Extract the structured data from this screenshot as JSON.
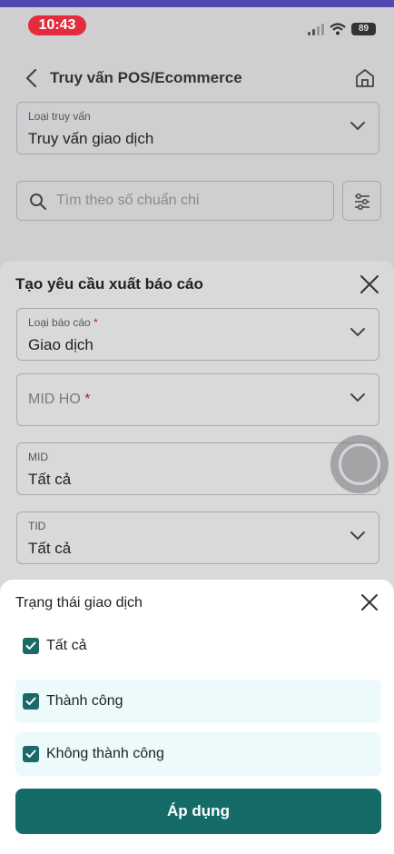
{
  "status_bar": {
    "time": "10:43",
    "battery": "89"
  },
  "nav": {
    "title": "Truy vấn POS/Ecommerce"
  },
  "query_type": {
    "label": "Loại truy vấn",
    "value": "Truy vấn giao dịch"
  },
  "search": {
    "placeholder": "Tìm theo số chuẩn chi"
  },
  "report_sheet": {
    "title": "Tạo yêu cầu xuất báo cáo",
    "report_type": {
      "label": "Loại báo cáo",
      "required": "*",
      "value": "Giao dịch"
    },
    "mid_ho": {
      "placeholder": "MID HO",
      "required": "*"
    },
    "mid": {
      "label": "MID",
      "value": "Tất cả"
    },
    "tid": {
      "label": "TID",
      "value": "Tất cả"
    }
  },
  "filter_sheet": {
    "title": "Trạng thái giao dịch",
    "options": [
      {
        "label": "Tất cả",
        "checked": true
      },
      {
        "label": "Thành công",
        "checked": true
      },
      {
        "label": "Không thành công",
        "checked": true
      }
    ],
    "apply_label": "Áp dụng"
  },
  "colors": {
    "primary": "#156b68",
    "required": "#b52230",
    "option_selected_bg": "#ecfafb",
    "time_badge": "#e42c3f"
  },
  "icons": [
    "back-arrow-icon",
    "home-icon",
    "chevron-down-icon",
    "search-icon",
    "filter-sliders-icon",
    "close-icon",
    "checkbox-checked-icon",
    "signal-icon",
    "wifi-icon",
    "battery-icon"
  ]
}
